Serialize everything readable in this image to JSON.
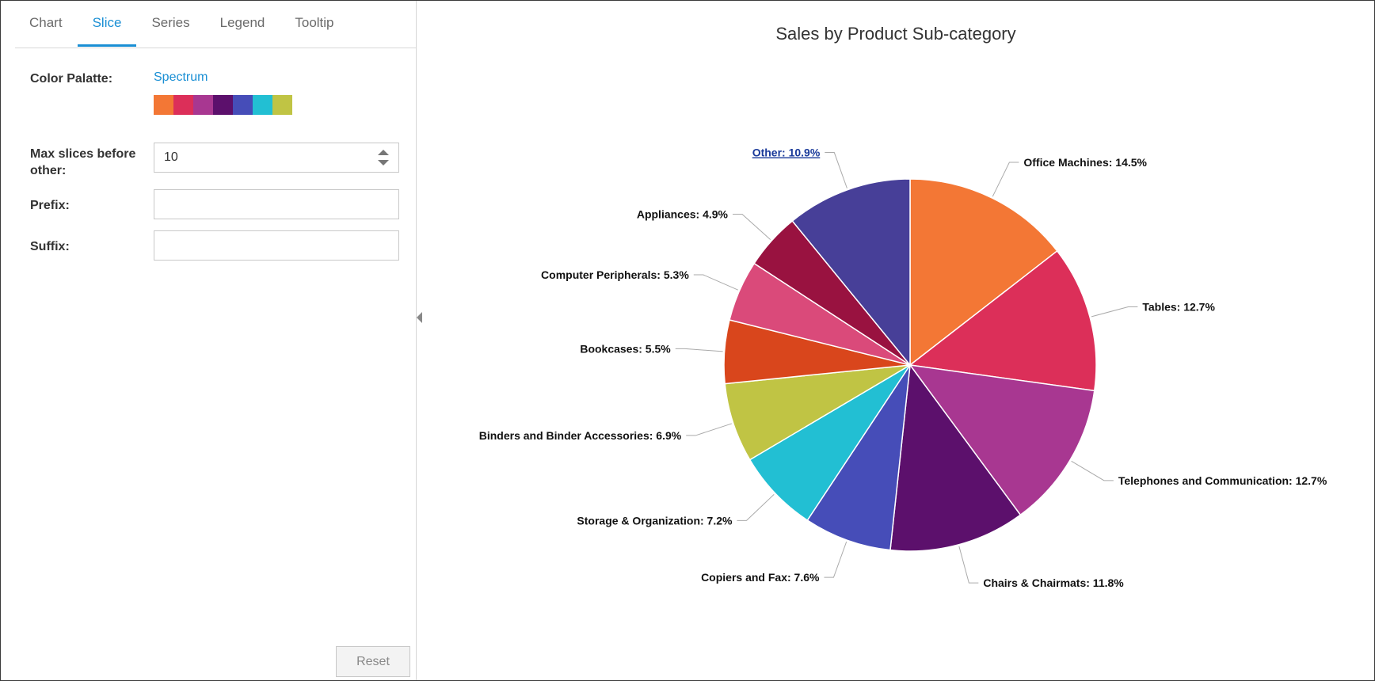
{
  "tabs": [
    "Chart",
    "Slice",
    "Series",
    "Legend",
    "Tooltip"
  ],
  "active_tab": "Slice",
  "settings": {
    "palette_label": "Color Palatte:",
    "palette_name": "Spectrum",
    "palette_colors": [
      "#f37735",
      "#dc2f59",
      "#a83791",
      "#5c106c",
      "#464db8",
      "#22bfd3",
      "#c0c444"
    ],
    "max_slices_label": "Max slices before other:",
    "max_slices_value": "10",
    "prefix_label": "Prefix:",
    "prefix_value": "",
    "suffix_label": "Suffix:",
    "suffix_value": ""
  },
  "reset_label": "Reset",
  "chart_data": {
    "type": "pie",
    "title": "Sales by Product Sub-category",
    "slices": [
      {
        "label": "Office Machines",
        "value": 14.5,
        "color": "#f37735"
      },
      {
        "label": "Tables",
        "value": 12.7,
        "color": "#dc2f59"
      },
      {
        "label": "Telephones and Communication",
        "value": 12.7,
        "color": "#a83791"
      },
      {
        "label": "Chairs & Chairmats",
        "value": 11.8,
        "color": "#5c106c"
      },
      {
        "label": "Copiers and Fax",
        "value": 7.6,
        "color": "#464db8"
      },
      {
        "label": "Storage & Organization",
        "value": 7.2,
        "color": "#22bfd3"
      },
      {
        "label": "Binders and Binder Accessories",
        "value": 6.9,
        "color": "#c0c444"
      },
      {
        "label": "Bookcases",
        "value": 5.5,
        "color": "#d9461c"
      },
      {
        "label": "Computer Peripherals",
        "value": 5.3,
        "color": "#da4a7a"
      },
      {
        "label": "Appliances",
        "value": 4.9,
        "color": "#991240"
      },
      {
        "label": "Other",
        "value": 10.9,
        "color": "#473f98"
      }
    ],
    "value_suffix": "%"
  }
}
